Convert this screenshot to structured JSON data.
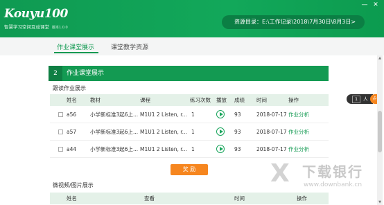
{
  "header": {
    "logo_text": "Kouyu100",
    "slogan": "智慧学习空间互动课堂",
    "version": "版本1.0.0",
    "resource_path": "资源目录：E:\\工作记录\\2018\\7月30日\\8月3日>"
  },
  "window_controls": {
    "min": "—",
    "close": "✕"
  },
  "tabs": [
    {
      "label": "作业课堂展示",
      "active": true
    },
    {
      "label": "课堂教学资源",
      "active": false
    }
  ],
  "section": {
    "number": "2",
    "title": "作业课堂展示"
  },
  "followup": {
    "title": "跟读作业展示",
    "columns": [
      "姓名",
      "教材",
      "课程",
      "练习次数",
      "播放",
      "成绩",
      "时间",
      "操作"
    ],
    "rows": [
      {
        "name": "a56",
        "textbook": "小学新标准3起6上...",
        "course": "M1U1 2 Listen, r...",
        "count": "1",
        "score": "93",
        "time": "2018-07-17",
        "action": "作业分析"
      },
      {
        "name": "a57",
        "textbook": "小学新标准3起6上...",
        "course": "M1U1 2 Listen, r...",
        "count": "1",
        "score": "93",
        "time": "2018-07-17",
        "action": "作业分析"
      },
      {
        "name": "a44",
        "textbook": "小学新标准3起6上...",
        "course": "M1U1 2 Listen, r...",
        "count": "1",
        "score": "93",
        "time": "2018-07-17",
        "action": "作业分析"
      }
    ],
    "reward_label": "奖 励"
  },
  "micro": {
    "title": "微视频/图片展示",
    "columns": [
      "姓名",
      "查看",
      "时间",
      "操作"
    ]
  },
  "side_widget": {
    "count": "1",
    "unit": "人",
    "button": "点名"
  },
  "watermark": {
    "mark": "X",
    "text": "下载银行",
    "url": "www.downbank.cn"
  },
  "colors": {
    "brand_green": "#139a52",
    "orange": "#f6861f"
  }
}
